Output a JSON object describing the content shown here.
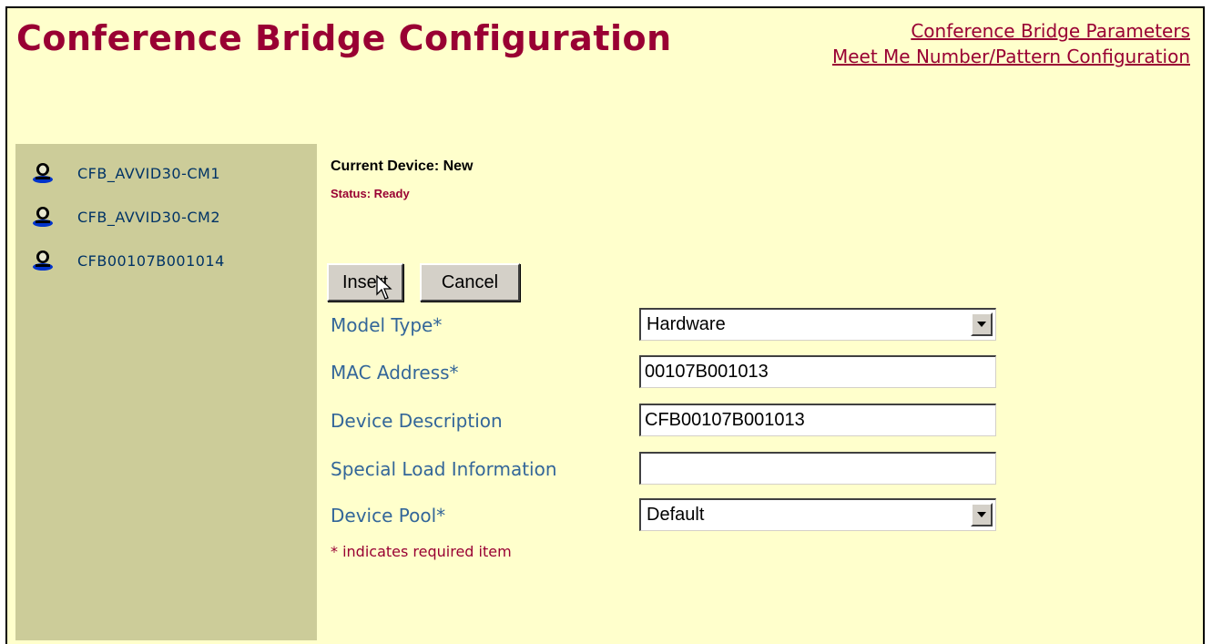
{
  "header": {
    "title": "Conference Bridge Configuration",
    "links": [
      "Conference Bridge Parameters",
      "Meet Me Number/Pattern Configuration"
    ]
  },
  "sidebar": {
    "items": [
      {
        "label": "CFB_AVVID30-CM1",
        "icon": "conference-bridge-icon"
      },
      {
        "label": "CFB_AVVID30-CM2",
        "icon": "conference-bridge-icon"
      },
      {
        "label": "CFB00107B001014",
        "icon": "conference-bridge-icon"
      }
    ]
  },
  "device": {
    "current": "Current Device: New",
    "status": "Status:  Ready"
  },
  "buttons": {
    "insert": "Insert",
    "cancel": "Cancel"
  },
  "form": {
    "model_type": {
      "label": "Model Type*",
      "value": "Hardware"
    },
    "mac_address": {
      "label": "MAC Address*",
      "value": "00107B001013"
    },
    "device_description": {
      "label": "Device Description",
      "value": "CFB00107B001013"
    },
    "special_load": {
      "label": "Special Load Information",
      "value": ""
    },
    "device_pool": {
      "label": "Device Pool*",
      "value": "Default"
    }
  },
  "required_note": "* indicates required item",
  "colors": {
    "background": "#ffffcc",
    "sidebar": "#cccc99",
    "title": "#990033",
    "label": "#336699"
  }
}
